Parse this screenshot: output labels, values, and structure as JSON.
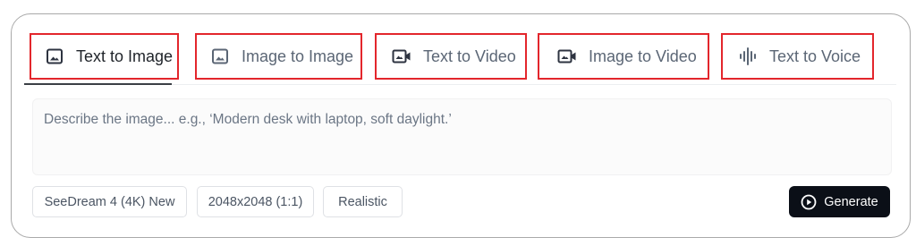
{
  "tabs": [
    {
      "label": "Text to Image",
      "icon": "image-icon",
      "active": true
    },
    {
      "label": "Image to Image",
      "icon": "image-icon",
      "active": false
    },
    {
      "label": "Text to Video",
      "icon": "video-camera-icon",
      "active": false
    },
    {
      "label": "Image to Video",
      "icon": "video-camera-icon",
      "active": false
    },
    {
      "label": "Text to Voice",
      "icon": "audio-wave-icon",
      "active": false
    }
  ],
  "prompt": {
    "value": "",
    "placeholder": "Describe the image... e.g., ‘Modern desk with laptop, soft daylight.’"
  },
  "options": {
    "model": "SeeDream 4 (4K) New",
    "size": "2048x2048 (1:1)",
    "style": "Realistic"
  },
  "generate_button": {
    "label": "Generate",
    "icon": "play-circle-icon"
  },
  "colors": {
    "highlight_border": "#e3262c",
    "button_bg": "#0b0f17",
    "active_text": "#1f2329",
    "inactive_text": "#5b6675"
  }
}
